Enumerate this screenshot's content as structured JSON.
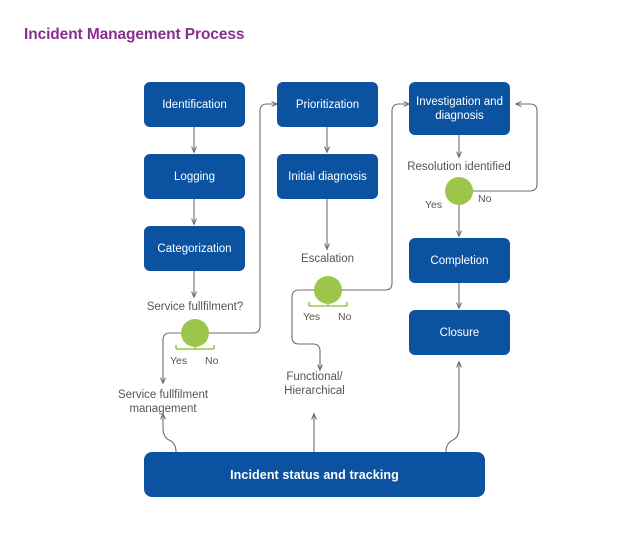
{
  "title": "Incident Management Process",
  "colors": {
    "title_purple": "#8a2f8f",
    "box_blue": "#0b53a1",
    "decision_green": "#9cc64b",
    "connector_gray": "#6e6e6e",
    "label_gray": "#595550",
    "background": "#ffffff"
  },
  "nodes": {
    "identification": "Identification",
    "logging": "Logging",
    "categorization": "Categorization",
    "prioritization": "Prioritization",
    "initial_diagnosis": "Initial diagnosis",
    "investigation": "Investigation\nand diagnosis",
    "completion": "Completion",
    "closure": "Closure",
    "status_bar": "Incident status and tracking"
  },
  "decisions": {
    "service_fullfilment": {
      "label": "Service fullfilment?",
      "yes": "Yes",
      "no": "No"
    },
    "escalation": {
      "label": "Escalation",
      "yes": "Yes",
      "no": "No"
    },
    "resolution_identified": {
      "label": "Resolution identified",
      "yes": "Yes",
      "no": "No"
    }
  },
  "terminals": {
    "service_fullfilment_management": "Service fullfilment\nmanagement",
    "functional_hierarchical": "Functional/\nHierarchical"
  }
}
